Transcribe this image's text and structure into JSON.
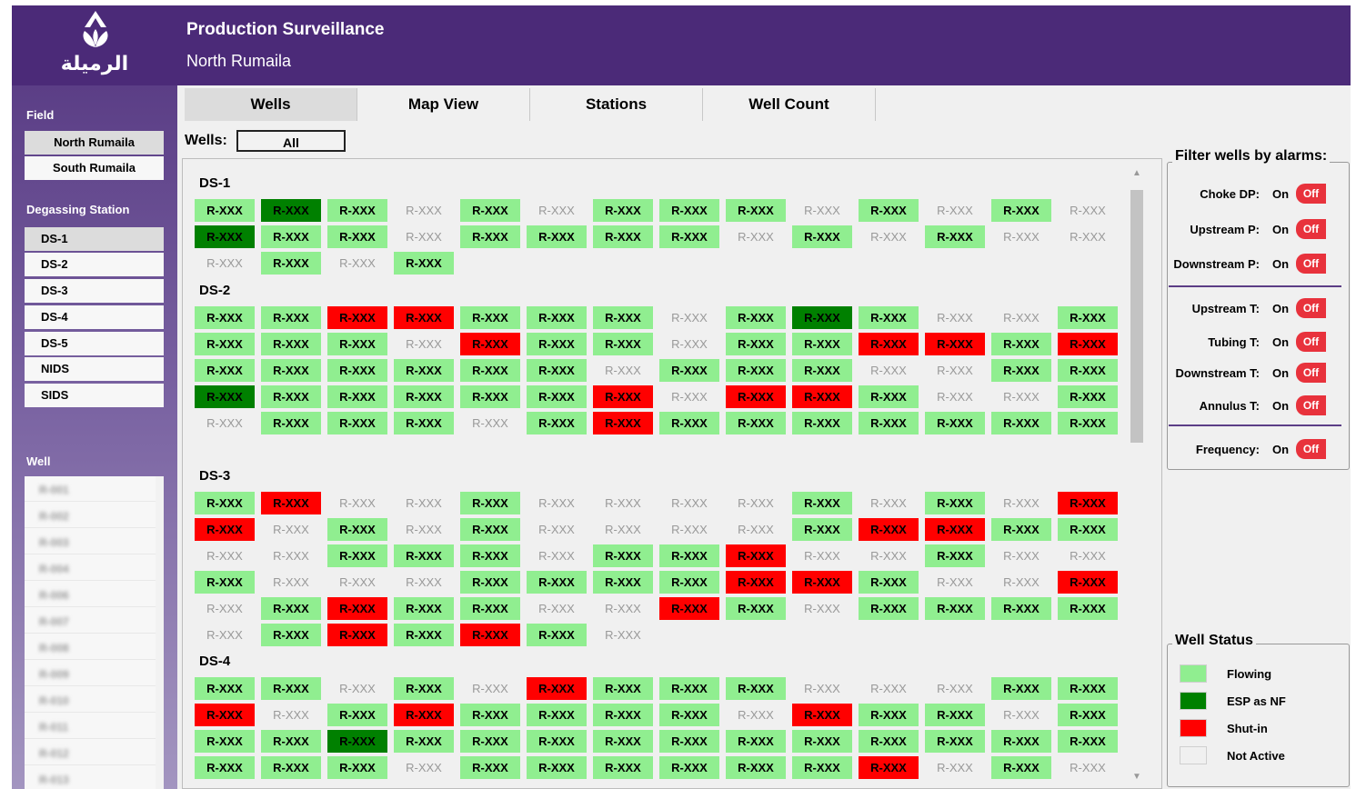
{
  "header": {
    "title": "Production Surveillance",
    "subtitle": "North Rumaila",
    "logo_text": "الرميلة"
  },
  "sidebar": {
    "field_label": "Field",
    "fields": [
      "North Rumaila",
      "South Rumaila"
    ],
    "selected_field": "North Rumaila",
    "station_label": "Degassing Station",
    "stations": [
      "DS-1",
      "DS-2",
      "DS-3",
      "DS-4",
      "DS-5",
      "NIDS",
      "SIDS"
    ],
    "selected_station": "DS-1",
    "well_label": "Well",
    "wells": [
      "R-001",
      "R-002",
      "R-003",
      "R-004",
      "R-006",
      "R-007",
      "R-008",
      "R-009",
      "R-010",
      "R-011",
      "R-012",
      "R-013"
    ]
  },
  "tabs": [
    "Wells",
    "Map View",
    "Stations",
    "Well Count"
  ],
  "active_tab": "Wells",
  "wells_filter": {
    "label": "Wells:",
    "value": "All"
  },
  "well_label_text": "R-XXX",
  "groups": [
    {
      "name": "DS-1",
      "rows": [
        "GEGNGNGGGNGNGN",
        "EGGNGGGGNGNGNN",
        "NGNG"
      ]
    },
    {
      "name": "DS-2",
      "rows": [
        "GGSSGGGNGEGNNG",
        "GGGNSGGNGGSSGS",
        "GGGGGGNGGGNNGG",
        "EGGGGGSNSSGNNG",
        "NGGGNGSGGGGGGG"
      ]
    },
    {
      "name": "DS-3",
      "rows": [
        "GSNNGNNNNGNGNS",
        "SNGNGNNNNGSSGG",
        "NNGGGNGGSNNGNN",
        "GNNNGGGGSSGNNS",
        "NGSGGNNSGNGGGG",
        "NGSGSGN"
      ]
    },
    {
      "name": "DS-4",
      "rows": [
        "GGNGNSGGGNNNGG",
        "SNGSGGGGNSGGNG",
        "GGEGGGGGGGGGGG",
        "GGGNGGGGGGSNGN"
      ]
    }
  ],
  "filters": {
    "title": "Filter wells by alarms:",
    "on_label": "On",
    "off_label": "Off",
    "items": [
      "Choke DP:",
      "Upstream P:",
      "Downstream P:",
      "Upstream T:",
      "Tubing T:",
      "Downstream T:",
      "Annulus T:",
      "Frequency:"
    ]
  },
  "legend": {
    "title": "Well Status",
    "items": [
      {
        "label": "Flowing",
        "color": "#90ee90"
      },
      {
        "label": "ESP as NF",
        "color": "#008000"
      },
      {
        "label": "Shut-in",
        "color": "#ff0000"
      },
      {
        "label": "Not Active",
        "color": "#f0f0f0"
      }
    ]
  },
  "colors": {
    "brand_purple": "#4b2a78",
    "flowing": "#90ee90",
    "esp": "#008000",
    "shut_in": "#ff0000",
    "inactive": "#f0f0f0",
    "off_toggle": "#e8323c"
  }
}
